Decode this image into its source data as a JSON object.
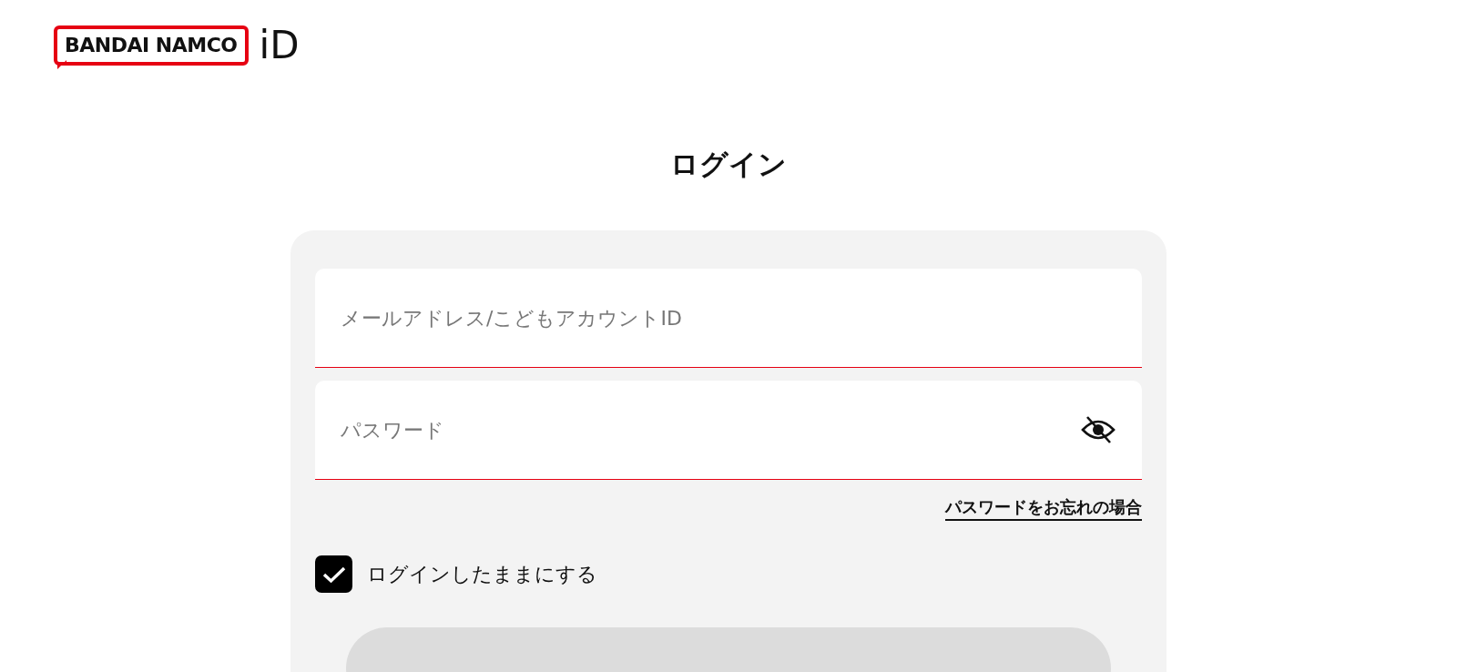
{
  "header": {
    "logo": {
      "brand": "BANDAI NAMCO",
      "suffix": "iD"
    }
  },
  "title": "ログイン",
  "form": {
    "fields": [
      {
        "kind": "text",
        "placeholder": "メールアドレス/こどもアカウントID"
      },
      {
        "kind": "password",
        "placeholder": "パスワード",
        "reveal": false
      }
    ],
    "forgot_link": "パスワードをお忘れの場合",
    "remember": {
      "label": "ログインしたままにする",
      "checked": true
    },
    "submit": {
      "disabled": true
    }
  }
}
